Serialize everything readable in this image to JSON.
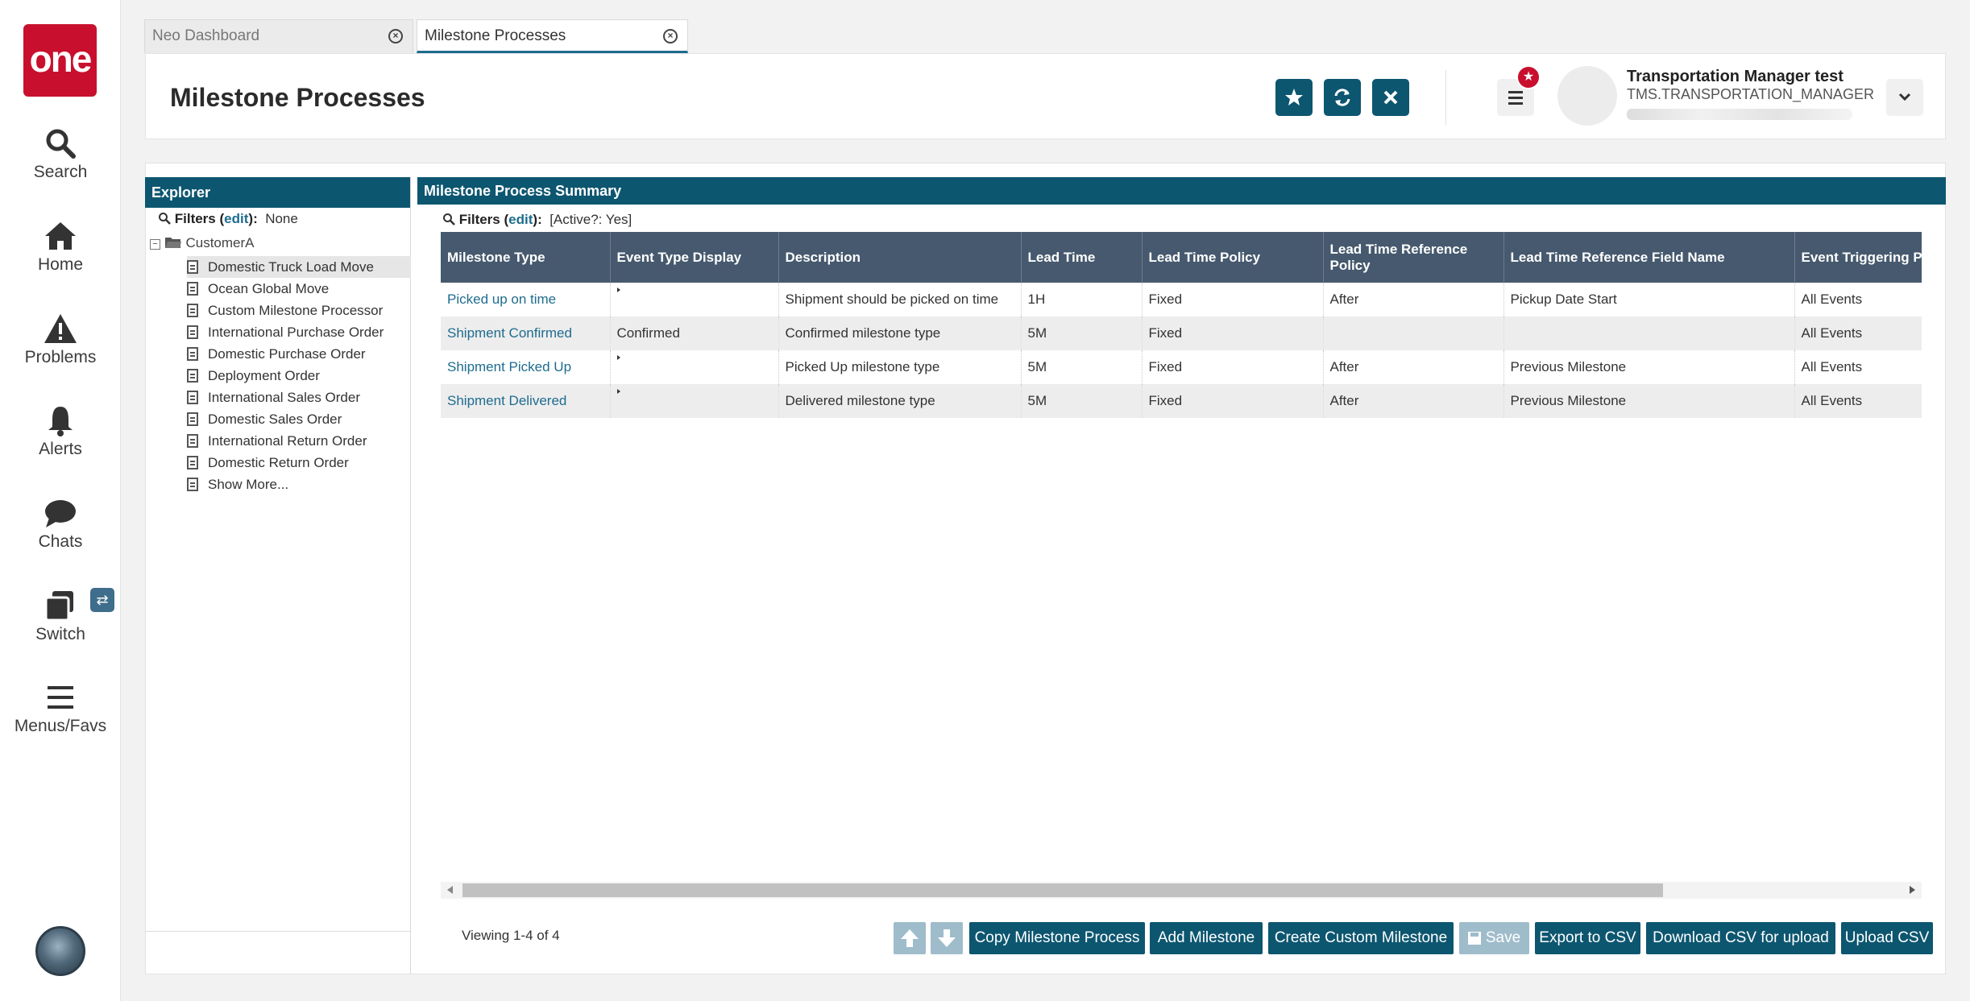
{
  "nav": {
    "logo": "one",
    "items": [
      {
        "label": "Search",
        "icon": "search-icon"
      },
      {
        "label": "Home",
        "icon": "home-icon"
      },
      {
        "label": "Problems",
        "icon": "warning-icon"
      },
      {
        "label": "Alerts",
        "icon": "bell-icon"
      },
      {
        "label": "Chats",
        "icon": "chat-icon"
      },
      {
        "label": "Switch",
        "icon": "switch-icon"
      },
      {
        "label": "Menus/Favs",
        "icon": "hamburger-icon"
      }
    ]
  },
  "tabs": [
    {
      "label": "Neo Dashboard",
      "active": false
    },
    {
      "label": "Milestone Processes",
      "active": true
    }
  ],
  "header": {
    "title": "Milestone Processes",
    "user_name": "Transportation Manager test",
    "user_role": "TMS.TRANSPORTATION_MANAGER"
  },
  "explorer": {
    "title": "Explorer",
    "filters_label": "Filters",
    "filters_edit": "edit",
    "filters_value": "None",
    "root": "CustomerA",
    "items": [
      "Domestic Truck Load Move",
      "Ocean Global Move",
      "Custom Milestone Processor",
      "International Purchase Order",
      "Domestic Purchase Order",
      "Deployment Order",
      "International Sales Order",
      "Domestic Sales Order",
      "International Return Order",
      "Domestic Return Order",
      "Show More..."
    ],
    "selected_index": 0
  },
  "summary": {
    "title": "Milestone Process Summary",
    "filters_label": "Filters",
    "filters_edit": "edit",
    "filters_value": "[Active?: Yes]",
    "columns": [
      "Milestone Type",
      "Event Type Display",
      "Description",
      "Lead Time",
      "Lead Time Policy",
      "Lead Time Reference Policy",
      "Lead Time Reference Field Name",
      "Event Triggering Po"
    ],
    "rows": [
      [
        "Picked up on time",
        "",
        "Shipment should be picked on time",
        "1H",
        "Fixed",
        "After",
        "Pickup Date Start",
        "All Events"
      ],
      [
        "Shipment Confirmed",
        "Confirmed",
        "Confirmed milestone type",
        "5M",
        "Fixed",
        "",
        "",
        "All Events"
      ],
      [
        "Shipment Picked Up",
        "",
        "Picked Up milestone type",
        "5M",
        "Fixed",
        "After",
        "Previous Milestone",
        "All Events"
      ],
      [
        "Shipment Delivered",
        "",
        "Delivered milestone type",
        "5M",
        "Fixed",
        "After",
        "Previous Milestone",
        "All Events"
      ]
    ]
  },
  "footer": {
    "viewing": "Viewing 1-4 of 4",
    "copy": "Copy Milestone Process",
    "add": "Add Milestone",
    "create": "Create Custom Milestone",
    "save": "Save",
    "export": "Export to CSV",
    "download": "Download CSV for upload",
    "upload": "Upload CSV"
  },
  "colors": {
    "brand": "#c8102e",
    "primary": "#0d5670",
    "table_header": "#46596e",
    "link": "#1e6c8f"
  }
}
